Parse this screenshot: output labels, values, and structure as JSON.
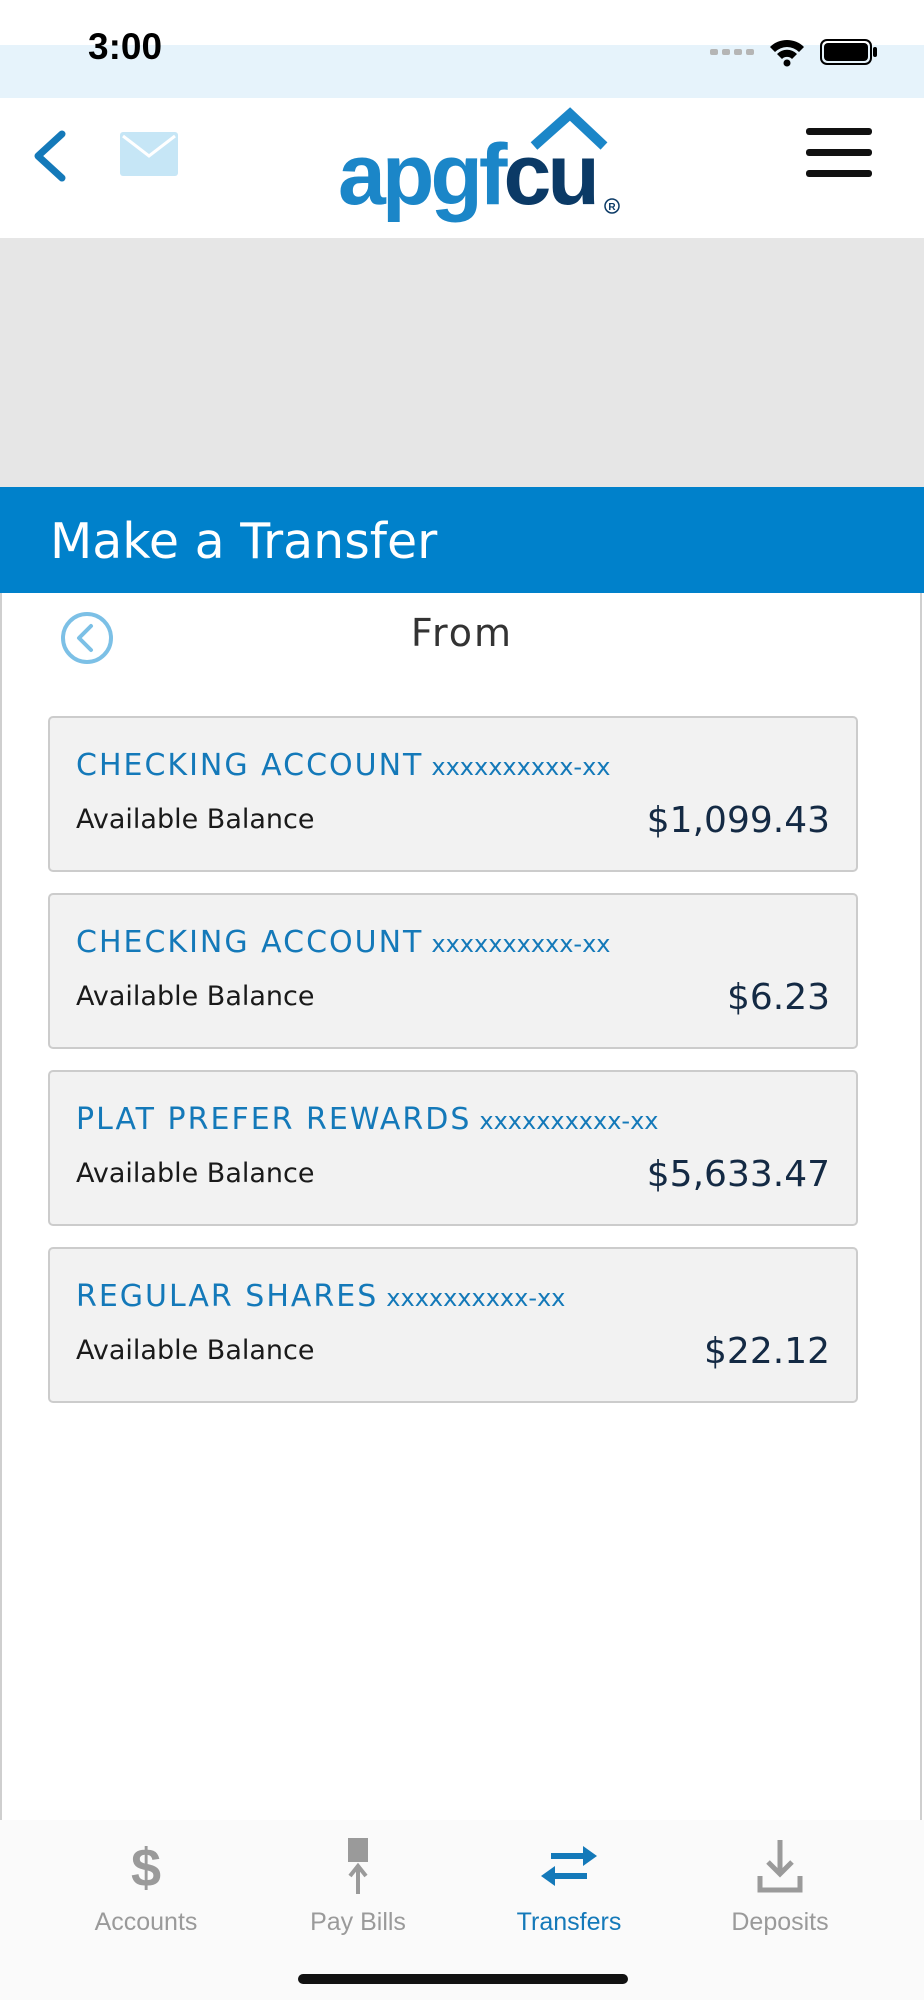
{
  "status_bar": {
    "time": "3:00"
  },
  "header": {
    "logo": {
      "main": "apgf",
      "accent": "cu"
    }
  },
  "page": {
    "title": "Make a Transfer",
    "section_label": "From"
  },
  "accounts": [
    {
      "name": "CHECKING ACCOUNT",
      "mask": "xxxxxxxxxx-xx",
      "balance_label": "Available Balance",
      "amount": "$1,099.43"
    },
    {
      "name": "CHECKING ACCOUNT",
      "mask": "xxxxxxxxxx-xx",
      "balance_label": "Available Balance",
      "amount": "$6.23"
    },
    {
      "name": "PLAT PREFER REWARDS",
      "mask": "xxxxxxxxxx-xx",
      "balance_label": "Available Balance",
      "amount": "$5,633.47"
    },
    {
      "name": "REGULAR SHARES",
      "mask": "xxxxxxxxxx-xx",
      "balance_label": "Available Balance",
      "amount": "$22.12"
    }
  ],
  "bottom_nav": [
    {
      "label": "Accounts",
      "icon": "dollar-icon",
      "active": false
    },
    {
      "label": "Pay Bills",
      "icon": "pay-bills-icon",
      "active": false
    },
    {
      "label": "Transfers",
      "icon": "transfer-arrows-icon",
      "active": true
    },
    {
      "label": "Deposits",
      "icon": "download-icon",
      "active": false
    }
  ],
  "colors": {
    "brand_blue": "#0081cb",
    "account_name": "#1479b9",
    "logo_dark": "#0b3a66",
    "banner_gray": "#e6e6e6",
    "nav_inactive": "#9a9a9a"
  }
}
